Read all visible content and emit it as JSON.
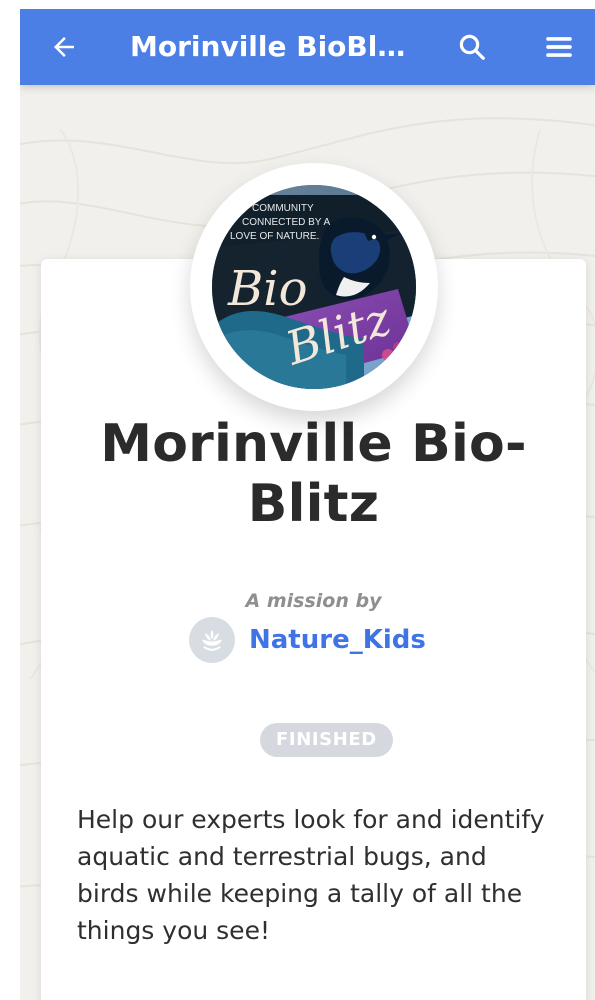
{
  "colors": {
    "top_bar": "#4c7fe6",
    "author_link": "#3e74e6",
    "badge_bg": "#d5d9df",
    "title_text": "#2b2b2b"
  },
  "top_bar": {
    "title": "Morinville BioBl…",
    "back_icon": "arrow-left-icon",
    "search_icon": "search-icon",
    "menu_icon": "hamburger-menu-icon"
  },
  "mission": {
    "title": "Morinville Bio-Blitz",
    "by_label": "A mission by",
    "author": {
      "name": "Nature_Kids",
      "icon": "lotus-icon"
    },
    "status": "FINISHED",
    "description": "Help our experts look for and identify aquatic and terrestrial bugs, and birds while keeping a tally of all the things you see!",
    "avatar": {
      "text_lines": [
        "COMMUNITY",
        "CONNECTED BY A",
        "LOVE OF NATURE."
      ],
      "logo_text_1": "Bio",
      "logo_text_2": "Blitz"
    }
  }
}
